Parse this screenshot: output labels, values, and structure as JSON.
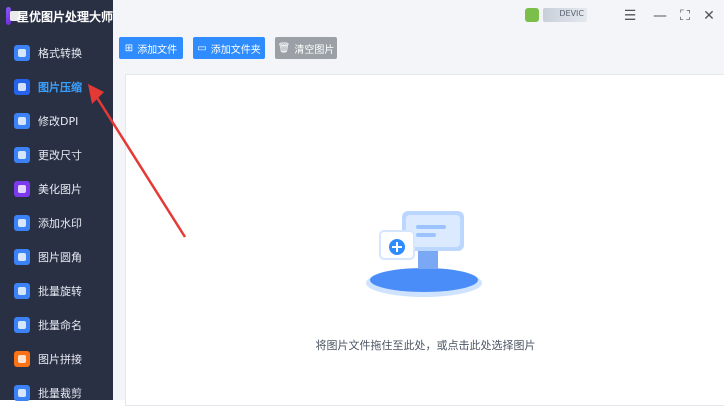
{
  "app": {
    "title": "星优图片处理大师",
    "brand_color": "#6d28d9"
  },
  "user": {
    "name": "DEVIC"
  },
  "window_controls": {
    "menu": "☰",
    "minimize": "—",
    "maximize": "⛶",
    "close": "✕"
  },
  "sidebar": {
    "items": [
      {
        "label": "格式转换",
        "icon": "format-convert-icon",
        "active": false
      },
      {
        "label": "图片压缩",
        "icon": "image-compress-icon",
        "active": true
      },
      {
        "label": "修改DPI",
        "icon": "dpi-icon",
        "active": false
      },
      {
        "label": "更改尺寸",
        "icon": "resize-icon",
        "active": false
      },
      {
        "label": "美化图片",
        "icon": "beautify-icon",
        "active": false
      },
      {
        "label": "添加水印",
        "icon": "watermark-icon",
        "active": false
      },
      {
        "label": "图片圆角",
        "icon": "rounded-corner-icon",
        "active": false
      },
      {
        "label": "批量旋转",
        "icon": "batch-rotate-icon",
        "active": false
      },
      {
        "label": "批量命名",
        "icon": "batch-rename-icon",
        "active": false
      },
      {
        "label": "图片拼接",
        "icon": "image-stitch-icon",
        "active": false
      },
      {
        "label": "批量裁剪",
        "icon": "batch-crop-icon",
        "active": false
      }
    ]
  },
  "toolbar": {
    "add_file_label": "添加文件",
    "add_folder_label": "添加文件夹",
    "clear_label": "清空图片"
  },
  "dropzone": {
    "hint": "将图片文件拖住至此处，或点击此处选择图片"
  },
  "colors": {
    "sidebar_bg": "#2a3043",
    "active_text": "#3aa0ff",
    "primary": "#2f8cff",
    "clear_button": "#9aa0a6",
    "annotation_arrow": "#e53935"
  }
}
